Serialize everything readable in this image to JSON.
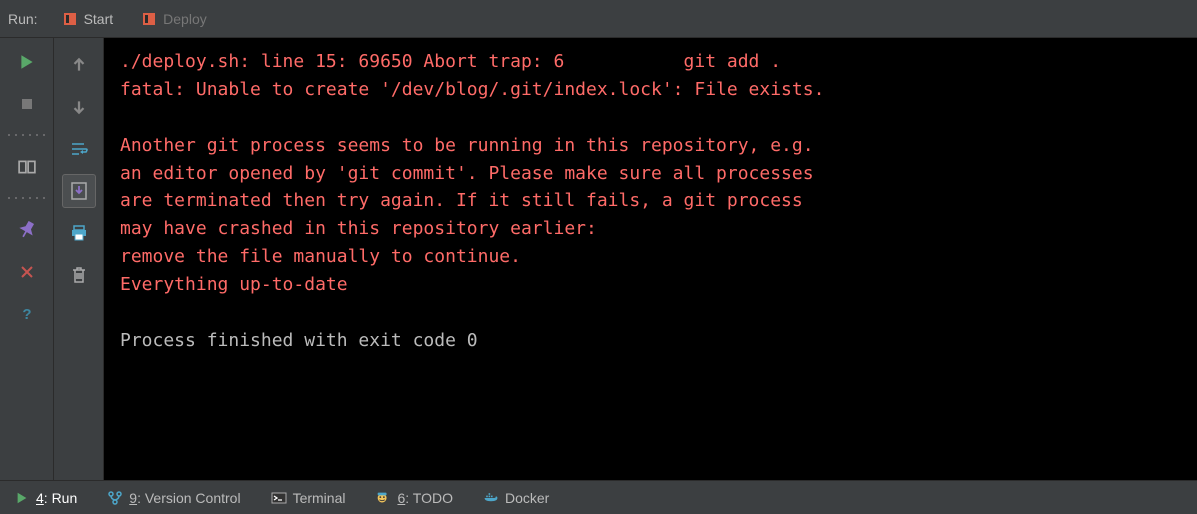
{
  "topbar": {
    "label": "Run:",
    "tabs": [
      {
        "label": "Start",
        "active": true
      },
      {
        "label": "Deploy",
        "active": false
      }
    ]
  },
  "left_toolbar": {
    "run": "Run",
    "stop": "Stop",
    "layout": "Layout",
    "pin": "Pin",
    "close": "Close",
    "help": "Help"
  },
  "console_toolbar": {
    "up": "Up the stack",
    "down": "Down the stack",
    "wrap": "Soft-Wrap",
    "scroll": "Scroll to End",
    "print": "Print",
    "clear": "Clear All"
  },
  "console": {
    "lines": [
      {
        "cls": "err",
        "text": "./deploy.sh: line 15: 69650 Abort trap: 6           git add ."
      },
      {
        "cls": "err",
        "text": "fatal: Unable to create '/dev/blog/.git/index.lock': File exists."
      },
      {
        "cls": "err",
        "text": ""
      },
      {
        "cls": "err",
        "text": "Another git process seems to be running in this repository, e.g."
      },
      {
        "cls": "err",
        "text": "an editor opened by 'git commit'. Please make sure all processes"
      },
      {
        "cls": "err",
        "text": "are terminated then try again. If it still fails, a git process"
      },
      {
        "cls": "err",
        "text": "may have crashed in this repository earlier:"
      },
      {
        "cls": "err",
        "text": "remove the file manually to continue."
      },
      {
        "cls": "err",
        "text": "Everything up-to-date"
      },
      {
        "cls": "normal",
        "text": ""
      },
      {
        "cls": "normal",
        "text": "Process finished with exit code 0"
      }
    ]
  },
  "bottombar": {
    "run": {
      "mnemonic": "4",
      "label": ": Run"
    },
    "vcs": {
      "mnemonic": "9",
      "label": ": Version Control"
    },
    "terminal": {
      "label": "Terminal"
    },
    "todo": {
      "mnemonic": "6",
      "label": ": TODO"
    },
    "docker": {
      "label": "Docker"
    }
  }
}
